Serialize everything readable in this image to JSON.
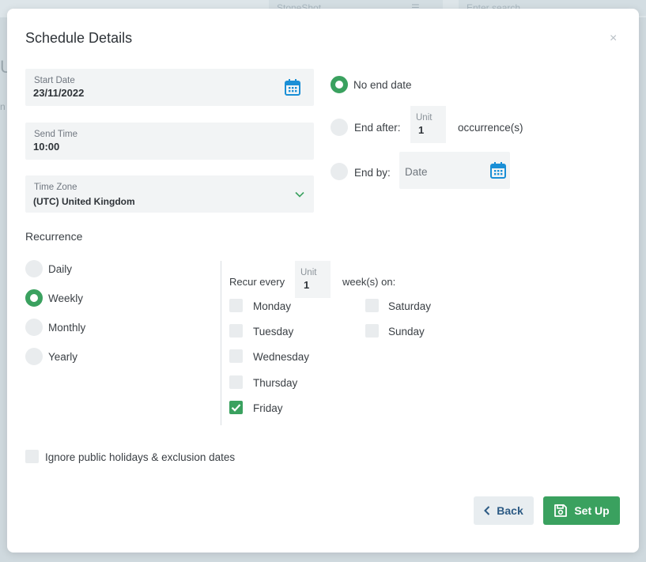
{
  "background": {
    "app_name": "StoneShot",
    "search_placeholder": "Enter search"
  },
  "modal": {
    "title": "Schedule Details",
    "close_label": "×"
  },
  "start_date": {
    "label": "Start Date",
    "value": "23/11/2022"
  },
  "send_time": {
    "label": "Send Time",
    "value": "10:00"
  },
  "time_zone": {
    "label": "Time Zone",
    "value": "(UTC) United Kingdom"
  },
  "end": {
    "no_end_label": "No end date",
    "after_label": "End after:",
    "after_unit_label": "Unit",
    "after_unit_value": "1",
    "occurrences_label": "occurrence(s)",
    "by_label": "End by:",
    "by_placeholder": "Date",
    "selected": "no_end"
  },
  "recurrence": {
    "title": "Recurrence",
    "options": [
      "Daily",
      "Weekly",
      "Monthly",
      "Yearly"
    ],
    "selected": "Weekly",
    "recur_every_label": "Recur every",
    "unit_label": "Unit",
    "unit_value": "1",
    "weeks_on_label": "week(s) on:",
    "days": {
      "monday": "Monday",
      "tuesday": "Tuesday",
      "wednesday": "Wednesday",
      "thursday": "Thursday",
      "friday": "Friday",
      "saturday": "Saturday",
      "sunday": "Sunday"
    },
    "checked_days": [
      "Friday"
    ]
  },
  "ignore_holidays_label": "Ignore public holidays & exclusion dates",
  "buttons": {
    "back": "Back",
    "setup": "Set Up"
  },
  "colors": {
    "accent": "#3aa15f",
    "icon_blue": "#1a8fd6",
    "link_blue": "#2c5a84"
  }
}
